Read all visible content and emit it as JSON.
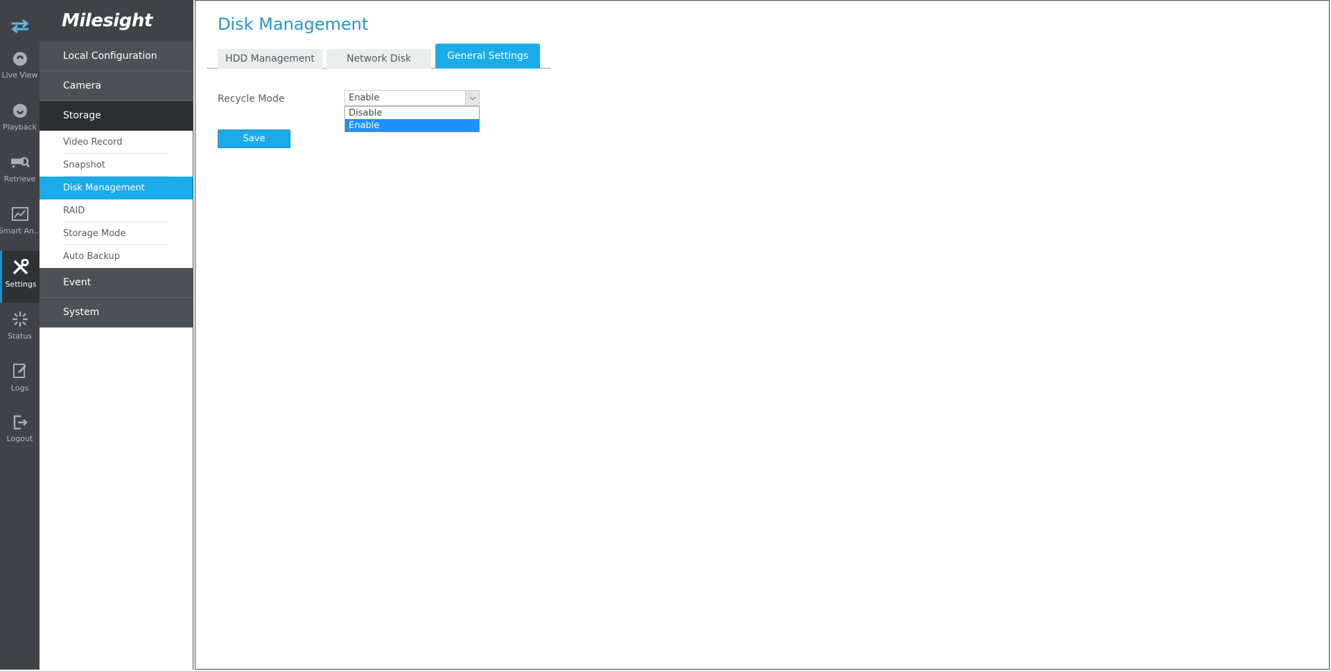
{
  "colors": {
    "accent": "#1aabe8",
    "title": "#2b93c9",
    "rail": "#3f4347",
    "selected_option": "#1e90ff"
  },
  "rail": {
    "toggle_icon": "swap-arrows-icon",
    "items": [
      {
        "label": "Live View",
        "icon": "live-view-icon"
      },
      {
        "label": "Playback",
        "icon": "playback-icon"
      },
      {
        "label": "Retrieve",
        "icon": "retrieve-icon"
      },
      {
        "label": "Smart An...",
        "icon": "smart-analytics-icon"
      },
      {
        "label": "Settings",
        "icon": "settings-icon",
        "active": true
      },
      {
        "label": "Status",
        "icon": "status-icon"
      },
      {
        "label": "Logs",
        "icon": "logs-icon"
      },
      {
        "label": "Logout",
        "icon": "logout-icon"
      }
    ]
  },
  "menu": {
    "logo": "Milesight",
    "groups": {
      "local_configuration": "Local Configuration",
      "camera": "Camera",
      "storage": "Storage",
      "event": "Event",
      "system": "System"
    },
    "storage_items": [
      "Video Record",
      "Snapshot",
      "Disk Management",
      "RAID",
      "Storage Mode",
      "Auto Backup"
    ],
    "active_item": "Disk Management"
  },
  "main": {
    "title": "Disk Management",
    "tabs": [
      "HDD Management",
      "Network Disk",
      "General Settings"
    ],
    "active_tab": "General Settings",
    "form": {
      "recycle_mode_label": "Recycle Mode",
      "recycle_mode_value": "Enable",
      "options": [
        "Disable",
        "Enable"
      ],
      "selected_option": "Enable"
    },
    "save_label": "Save"
  }
}
